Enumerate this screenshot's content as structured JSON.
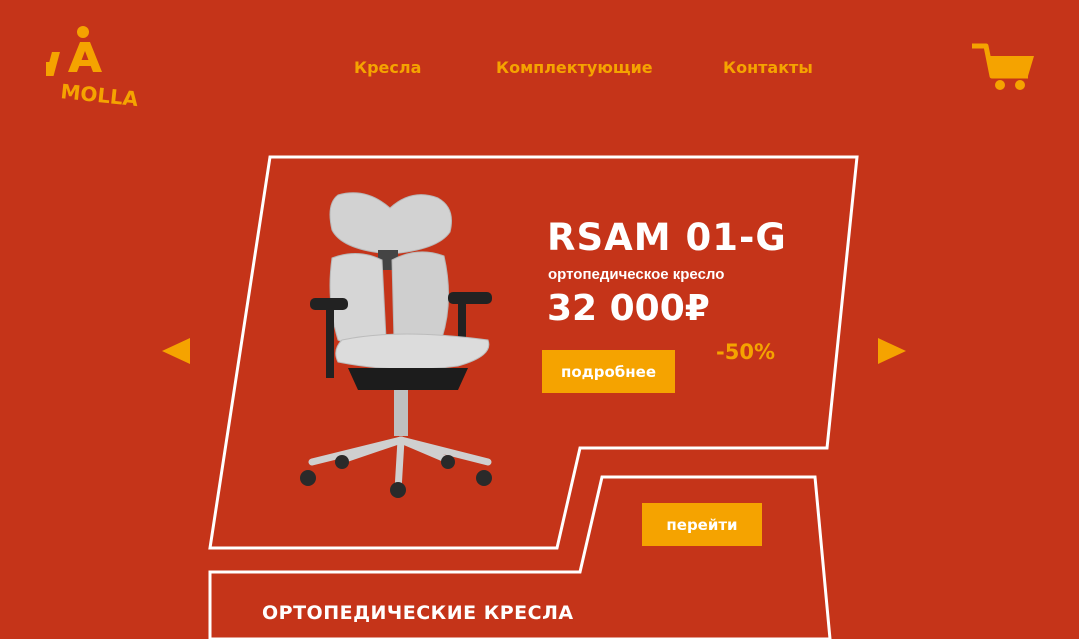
{
  "brand": {
    "logo_text": "MOLLA"
  },
  "nav": {
    "items": [
      {
        "label": "Кресла"
      },
      {
        "label": "Комплектующие"
      },
      {
        "label": "Контакты"
      }
    ]
  },
  "header": {
    "cart_icon": "cart-icon"
  },
  "slider": {
    "product_name": "RSAM 01-G",
    "product_subtitle": "ортопедическое кресло",
    "price": "32 000₽",
    "discount": "-50%",
    "more_button": "подробнее",
    "go_button": "перейти",
    "prev_icon": "arrow-left-icon",
    "next_icon": "arrow-right-icon"
  },
  "section": {
    "title": "ОРТОПЕДИЧЕСКИЕ КРЕСЛА"
  },
  "colors": {
    "background": "#c53419",
    "accent": "#f5a300",
    "text": "#ffffff"
  }
}
